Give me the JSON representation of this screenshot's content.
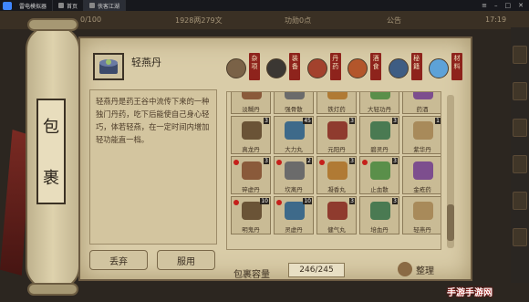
{
  "emulator": {
    "tabs": [
      {
        "label": "雷电模拟器"
      },
      {
        "label": "首页"
      },
      {
        "label": "侠客江湖"
      }
    ]
  },
  "hud": {
    "bag_counter": "0/100",
    "money": "1928两279文",
    "center": "功勋0点",
    "notice": "公告",
    "clock": "17:19"
  },
  "side_tab": {
    "chars": [
      "包",
      "裹"
    ]
  },
  "selected_item": {
    "name": "轻燕丹",
    "icon": "green-pill-box-icon"
  },
  "description": "轻燕丹是药王谷中流传下来的一种独门丹药，吃下后能使自己身心轻巧，体若轻燕，在一定时间内增加轻功能直一档。",
  "actions": {
    "discard": "丢弃",
    "use": "服用"
  },
  "filter_tabs": [
    {
      "label": "杂项",
      "icon": "sack-icon"
    },
    {
      "label": "装备",
      "icon": "anvil-icon"
    },
    {
      "label": "丹药",
      "icon": "pill-icon"
    },
    {
      "label": "酒食",
      "icon": "food-icon"
    },
    {
      "label": "秘籍",
      "icon": "book-icon"
    },
    {
      "label": "材料",
      "icon": "crystal-icon"
    }
  ],
  "inventory": [
    {
      "name": "淡糊丹",
      "count": "",
      "red": false
    },
    {
      "name": "强骨散",
      "count": "",
      "red": false
    },
    {
      "name": "铁灯药",
      "count": "",
      "red": false
    },
    {
      "name": "大轻功丹",
      "count": "",
      "red": false
    },
    {
      "name": "药酒",
      "count": "",
      "red": false
    },
    {
      "name": "真龙丹",
      "count": "3",
      "red": false
    },
    {
      "name": "大力丸",
      "count": "45",
      "red": false
    },
    {
      "name": "元阳丹",
      "count": "3",
      "red": false
    },
    {
      "name": "碧灵丹",
      "count": "3",
      "red": false
    },
    {
      "name": "紫华丹",
      "count": "1",
      "red": false
    },
    {
      "name": "碎虚丹",
      "count": "3",
      "red": true
    },
    {
      "name": "坎离丹",
      "count": "2",
      "red": true
    },
    {
      "name": "凝香丸",
      "count": "3",
      "red": true
    },
    {
      "name": "止血散",
      "count": "3",
      "red": true
    },
    {
      "name": "金疮药",
      "count": "",
      "red": false
    },
    {
      "name": "明鬼丹",
      "count": "10",
      "red": true
    },
    {
      "name": "灵虚丹",
      "count": "10",
      "red": true
    },
    {
      "name": "健气丸",
      "count": "3",
      "red": false
    },
    {
      "name": "培血丹",
      "count": "3",
      "red": false
    },
    {
      "name": "轻燕丹",
      "count": "",
      "red": false
    }
  ],
  "capacity": {
    "label": "包裹容量",
    "value": "246/245"
  },
  "sort_label": "整理",
  "watermark": "手游手游网"
}
